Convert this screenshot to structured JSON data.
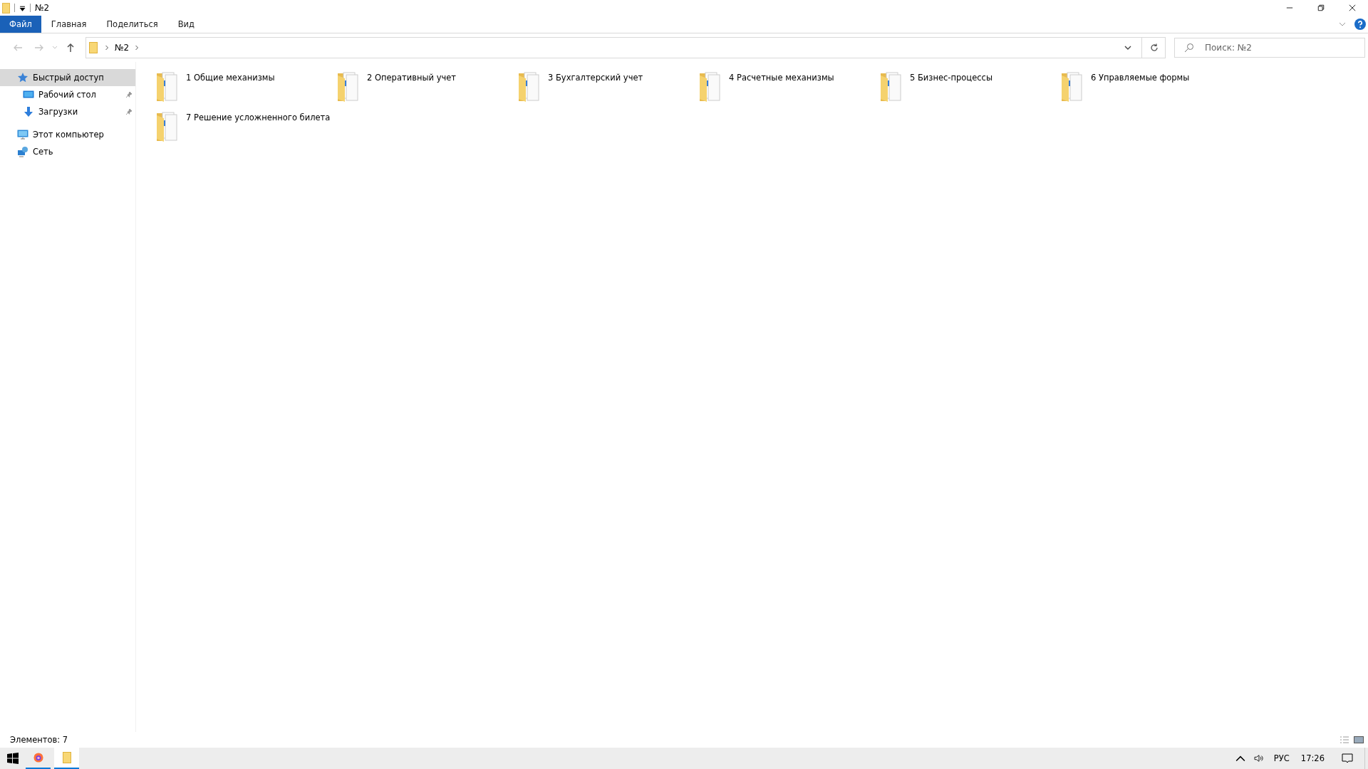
{
  "window": {
    "title": "№2"
  },
  "ribbon_tabs": [
    {
      "label": "Файл",
      "selected": true
    },
    {
      "label": "Главная",
      "selected": false
    },
    {
      "label": "Поделиться",
      "selected": false
    },
    {
      "label": "Вид",
      "selected": false
    }
  ],
  "address_bar": {
    "path": [
      "№2"
    ]
  },
  "search": {
    "placeholder": "Поиск: №2"
  },
  "sidebar": {
    "items": [
      {
        "label": "Быстрый доступ",
        "kind": "quick",
        "selected": true,
        "children": [
          {
            "label": "Рабочий стол",
            "kind": "desktop",
            "selected": false,
            "pinned": true
          },
          {
            "label": "Загрузки",
            "kind": "downloads",
            "selected": false,
            "pinned": true
          }
        ]
      },
      {
        "label": "Этот компьютер",
        "kind": "computer",
        "selected": false
      },
      {
        "label": "Сеть",
        "kind": "network",
        "selected": false
      }
    ]
  },
  "folders": [
    {
      "name": "1 Общие механизмы"
    },
    {
      "name": "2 Оперативный учет"
    },
    {
      "name": "3 Бухгалтерский учет"
    },
    {
      "name": "4 Расчетные механизмы"
    },
    {
      "name": "5 Бизнес-процессы"
    },
    {
      "name": "6 Управляемые формы"
    },
    {
      "name": "7 Решение усложненного билета"
    }
  ],
  "status_bar": {
    "text": "Элементов: 7"
  },
  "taskbar": {
    "apps": [
      {
        "kind": "browser",
        "active": false
      },
      {
        "kind": "explorer",
        "active": true
      }
    ],
    "language": "РУС",
    "time": "17:26"
  }
}
